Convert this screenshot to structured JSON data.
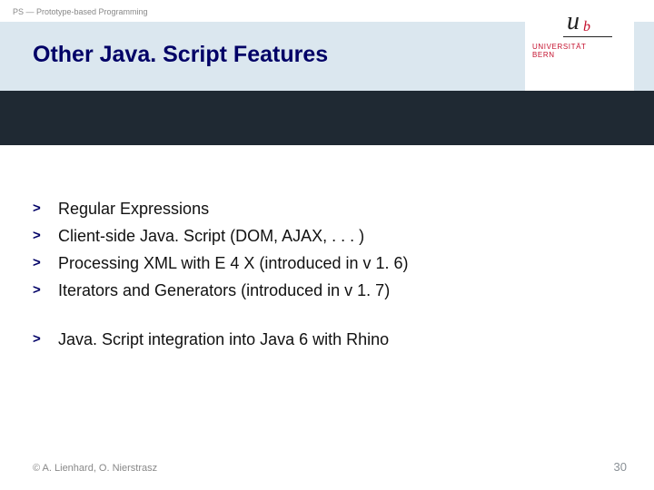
{
  "course_label": "PS — Prototype-based Programming",
  "title": "Other Java. Script Features",
  "logo": {
    "u": "u",
    "b": "b",
    "line1": "UNIVERSITÄT",
    "line2": "BERN"
  },
  "bullets_group1": [
    "Regular Expressions",
    "Client-side Java. Script (DOM, AJAX, . . . )",
    "Processing XML with E 4 X (introduced in v 1. 6)",
    "Iterators and Generators (introduced in v 1. 7)"
  ],
  "bullets_group2": [
    "Java. Script integration into Java 6 with Rhino"
  ],
  "bullet_marker": ">",
  "footer": "© A. Lienhard, O. Nierstrasz",
  "page_number": "30"
}
